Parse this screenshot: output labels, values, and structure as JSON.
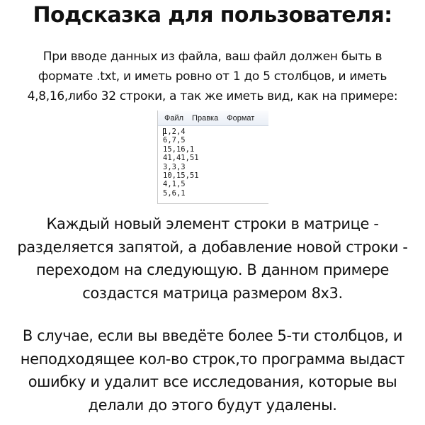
{
  "title": "Подсказка для пользователя:",
  "intro": {
    "lines": [
      "При вводе данных из файла, ваш файл должен быть в",
      "формате .txt, и иметь ровно  от 1 до 5 столбцов, и иметь",
      "4,8,16,либо 32 строки, а так же иметь вид, как на примере:"
    ]
  },
  "notepad": {
    "menu": [
      "Файл",
      "Правка",
      "Формат"
    ],
    "rows": [
      "1,2,4",
      "6,7,5",
      "15,16,1",
      "41,41,51",
      "3,3,3",
      "10,15,51",
      "4,1,5",
      "5,6,1"
    ]
  },
  "paragraph1": {
    "lines": [
      "Каждый новый элемент строки в матрице -",
      "разделяется запятой, а добавление новой строки -",
      "переходом на следующую. В данном примере",
      "создастся матрица размером 8x3."
    ]
  },
  "paragraph2": {
    "lines": [
      "В случае, если вы введёте более 5-ти столбцов, и",
      "неподходящее кол-во строк,то программа выдаст",
      "ошибку и удалит все исследования, которые вы",
      "делали до этого будут удалены."
    ]
  }
}
